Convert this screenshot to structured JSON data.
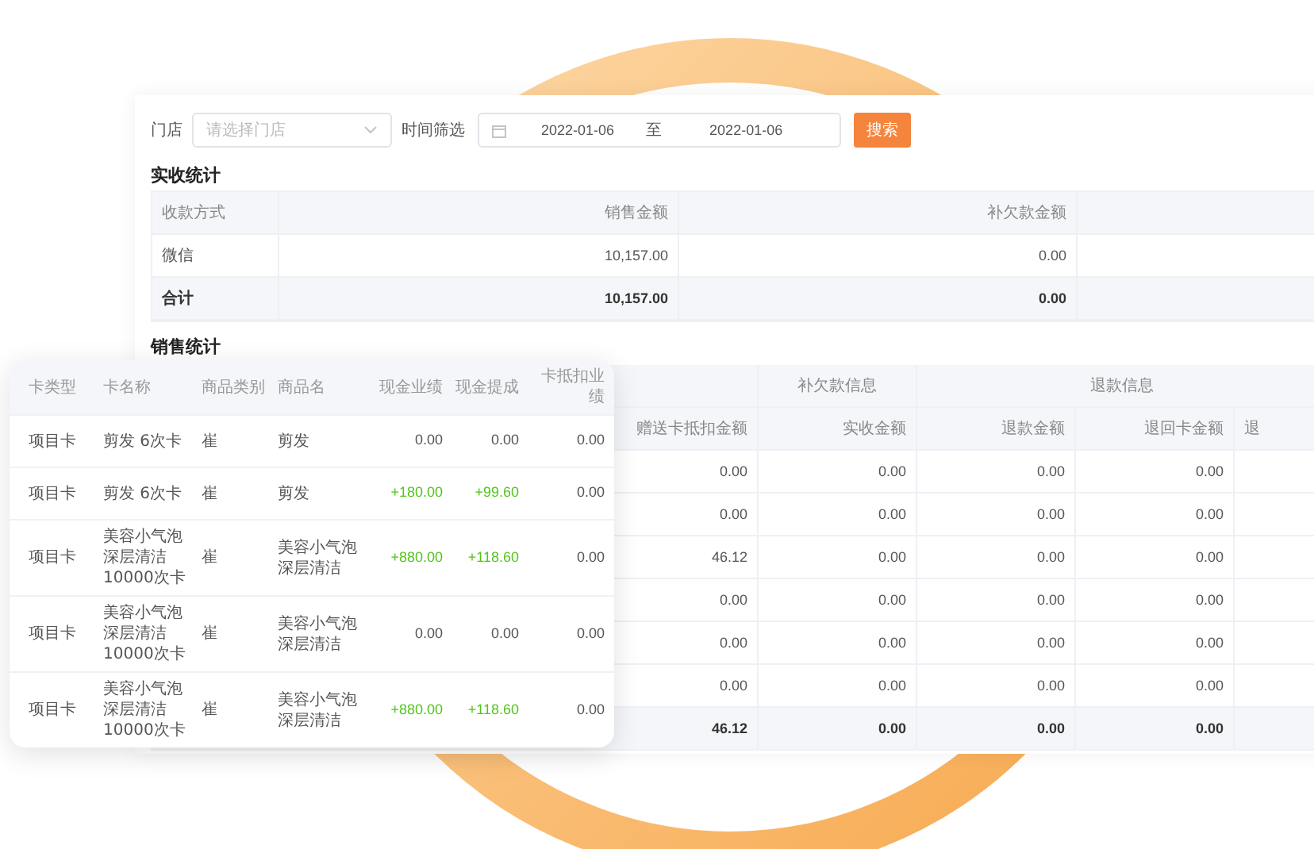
{
  "filter": {
    "store_label": "门店",
    "store_placeholder": "请选择门店",
    "time_label": "时间筛选",
    "start_date": "2022-01-06",
    "range_separator": "至",
    "end_date": "2022-01-06",
    "search_button": "搜索"
  },
  "receipts": {
    "title": "实收统计",
    "columns": [
      "收款方式",
      "销售金额",
      "补欠款金额"
    ],
    "rows": [
      {
        "cells": [
          "微信",
          "10,157.00",
          "0.00"
        ],
        "total": false
      },
      {
        "cells": [
          "合计",
          "10,157.00",
          "0.00"
        ],
        "total": true
      }
    ]
  },
  "sales": {
    "title": "销售统计",
    "group_headers": [
      "补欠款信息",
      "退款信息"
    ],
    "columns": [
      "赠送卡抵扣金额",
      "实收金额",
      "退款金额",
      "退回卡金额",
      "退"
    ],
    "rows": [
      {
        "cells": [
          "0.00",
          "0.00",
          "0.00",
          "0.00"
        ],
        "total": false
      },
      {
        "cells": [
          "0.00",
          "0.00",
          "0.00",
          "0.00"
        ],
        "total": false
      },
      {
        "cells": [
          "46.12",
          "0.00",
          "0.00",
          "0.00"
        ],
        "total": false
      },
      {
        "cells": [
          "0.00",
          "0.00",
          "0.00",
          "0.00"
        ],
        "total": false
      },
      {
        "cells": [
          "0.00",
          "0.00",
          "0.00",
          "0.00"
        ],
        "total": false
      },
      {
        "cells": [
          "0.00",
          "0.00",
          "0.00",
          "0.00"
        ],
        "total": false
      },
      {
        "cells": [
          "46.12",
          "0.00",
          "0.00",
          "0.00"
        ],
        "total": true
      }
    ]
  },
  "card_table": {
    "columns": [
      "卡类型",
      "卡名称",
      "商品类别",
      "商品名",
      "现金业绩",
      "现金提成",
      "卡抵扣业绩"
    ],
    "rows": [
      {
        "card_type": "项目卡",
        "card_name": "剪发 6次卡",
        "category": "崔",
        "product": "剪发",
        "cash_performance": {
          "text": "0.00",
          "positive": false
        },
        "cash_commission": {
          "text": "0.00",
          "positive": false
        },
        "card_deduction": "0.00"
      },
      {
        "card_type": "项目卡",
        "card_name": "剪发 6次卡",
        "category": "崔",
        "product": "剪发",
        "cash_performance": {
          "text": "+180.00",
          "positive": true
        },
        "cash_commission": {
          "text": "+99.60",
          "positive": true
        },
        "card_deduction": "0.00"
      },
      {
        "card_type": "项目卡",
        "card_name": "美容小气泡深层清洁 10000次卡",
        "category": "崔",
        "product": "美容小气泡深层清洁",
        "cash_performance": {
          "text": "+880.00",
          "positive": true
        },
        "cash_commission": {
          "text": "+118.60",
          "positive": true
        },
        "card_deduction": "0.00"
      },
      {
        "card_type": "项目卡",
        "card_name": "美容小气泡深层清洁 10000次卡",
        "category": "崔",
        "product": "美容小气泡深层清洁",
        "cash_performance": {
          "text": "0.00",
          "positive": false
        },
        "cash_commission": {
          "text": "0.00",
          "positive": false
        },
        "card_deduction": "0.00"
      },
      {
        "card_type": "项目卡",
        "card_name": "美容小气泡深层清洁 10000次卡",
        "category": "崔",
        "product": "美容小气泡深层清洁",
        "cash_performance": {
          "text": "+880.00",
          "positive": true
        },
        "cash_commission": {
          "text": "+118.60",
          "positive": true
        },
        "card_deduction": "0.00"
      }
    ]
  }
}
